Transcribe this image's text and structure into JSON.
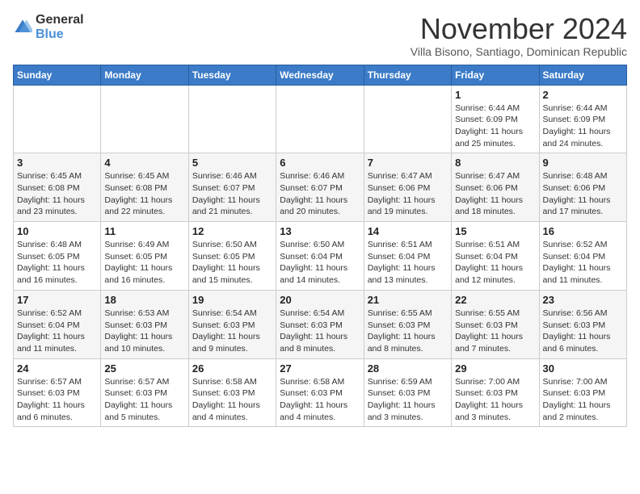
{
  "header": {
    "logo": {
      "text_general": "General",
      "text_blue": "Blue"
    },
    "title": "November 2024",
    "subtitle": "Villa Bisono, Santiago, Dominican Republic"
  },
  "calendar": {
    "days_of_week": [
      "Sunday",
      "Monday",
      "Tuesday",
      "Wednesday",
      "Thursday",
      "Friday",
      "Saturday"
    ],
    "weeks": [
      [
        {
          "day": "",
          "info": ""
        },
        {
          "day": "",
          "info": ""
        },
        {
          "day": "",
          "info": ""
        },
        {
          "day": "",
          "info": ""
        },
        {
          "day": "",
          "info": ""
        },
        {
          "day": "1",
          "info": "Sunrise: 6:44 AM\nSunset: 6:09 PM\nDaylight: 11 hours and 25 minutes."
        },
        {
          "day": "2",
          "info": "Sunrise: 6:44 AM\nSunset: 6:09 PM\nDaylight: 11 hours and 24 minutes."
        }
      ],
      [
        {
          "day": "3",
          "info": "Sunrise: 6:45 AM\nSunset: 6:08 PM\nDaylight: 11 hours and 23 minutes."
        },
        {
          "day": "4",
          "info": "Sunrise: 6:45 AM\nSunset: 6:08 PM\nDaylight: 11 hours and 22 minutes."
        },
        {
          "day": "5",
          "info": "Sunrise: 6:46 AM\nSunset: 6:07 PM\nDaylight: 11 hours and 21 minutes."
        },
        {
          "day": "6",
          "info": "Sunrise: 6:46 AM\nSunset: 6:07 PM\nDaylight: 11 hours and 20 minutes."
        },
        {
          "day": "7",
          "info": "Sunrise: 6:47 AM\nSunset: 6:06 PM\nDaylight: 11 hours and 19 minutes."
        },
        {
          "day": "8",
          "info": "Sunrise: 6:47 AM\nSunset: 6:06 PM\nDaylight: 11 hours and 18 minutes."
        },
        {
          "day": "9",
          "info": "Sunrise: 6:48 AM\nSunset: 6:06 PM\nDaylight: 11 hours and 17 minutes."
        }
      ],
      [
        {
          "day": "10",
          "info": "Sunrise: 6:48 AM\nSunset: 6:05 PM\nDaylight: 11 hours and 16 minutes."
        },
        {
          "day": "11",
          "info": "Sunrise: 6:49 AM\nSunset: 6:05 PM\nDaylight: 11 hours and 16 minutes."
        },
        {
          "day": "12",
          "info": "Sunrise: 6:50 AM\nSunset: 6:05 PM\nDaylight: 11 hours and 15 minutes."
        },
        {
          "day": "13",
          "info": "Sunrise: 6:50 AM\nSunset: 6:04 PM\nDaylight: 11 hours and 14 minutes."
        },
        {
          "day": "14",
          "info": "Sunrise: 6:51 AM\nSunset: 6:04 PM\nDaylight: 11 hours and 13 minutes."
        },
        {
          "day": "15",
          "info": "Sunrise: 6:51 AM\nSunset: 6:04 PM\nDaylight: 11 hours and 12 minutes."
        },
        {
          "day": "16",
          "info": "Sunrise: 6:52 AM\nSunset: 6:04 PM\nDaylight: 11 hours and 11 minutes."
        }
      ],
      [
        {
          "day": "17",
          "info": "Sunrise: 6:52 AM\nSunset: 6:04 PM\nDaylight: 11 hours and 11 minutes."
        },
        {
          "day": "18",
          "info": "Sunrise: 6:53 AM\nSunset: 6:03 PM\nDaylight: 11 hours and 10 minutes."
        },
        {
          "day": "19",
          "info": "Sunrise: 6:54 AM\nSunset: 6:03 PM\nDaylight: 11 hours and 9 minutes."
        },
        {
          "day": "20",
          "info": "Sunrise: 6:54 AM\nSunset: 6:03 PM\nDaylight: 11 hours and 8 minutes."
        },
        {
          "day": "21",
          "info": "Sunrise: 6:55 AM\nSunset: 6:03 PM\nDaylight: 11 hours and 8 minutes."
        },
        {
          "day": "22",
          "info": "Sunrise: 6:55 AM\nSunset: 6:03 PM\nDaylight: 11 hours and 7 minutes."
        },
        {
          "day": "23",
          "info": "Sunrise: 6:56 AM\nSunset: 6:03 PM\nDaylight: 11 hours and 6 minutes."
        }
      ],
      [
        {
          "day": "24",
          "info": "Sunrise: 6:57 AM\nSunset: 6:03 PM\nDaylight: 11 hours and 6 minutes."
        },
        {
          "day": "25",
          "info": "Sunrise: 6:57 AM\nSunset: 6:03 PM\nDaylight: 11 hours and 5 minutes."
        },
        {
          "day": "26",
          "info": "Sunrise: 6:58 AM\nSunset: 6:03 PM\nDaylight: 11 hours and 4 minutes."
        },
        {
          "day": "27",
          "info": "Sunrise: 6:58 AM\nSunset: 6:03 PM\nDaylight: 11 hours and 4 minutes."
        },
        {
          "day": "28",
          "info": "Sunrise: 6:59 AM\nSunset: 6:03 PM\nDaylight: 11 hours and 3 minutes."
        },
        {
          "day": "29",
          "info": "Sunrise: 7:00 AM\nSunset: 6:03 PM\nDaylight: 11 hours and 3 minutes."
        },
        {
          "day": "30",
          "info": "Sunrise: 7:00 AM\nSunset: 6:03 PM\nDaylight: 11 hours and 2 minutes."
        }
      ]
    ]
  }
}
